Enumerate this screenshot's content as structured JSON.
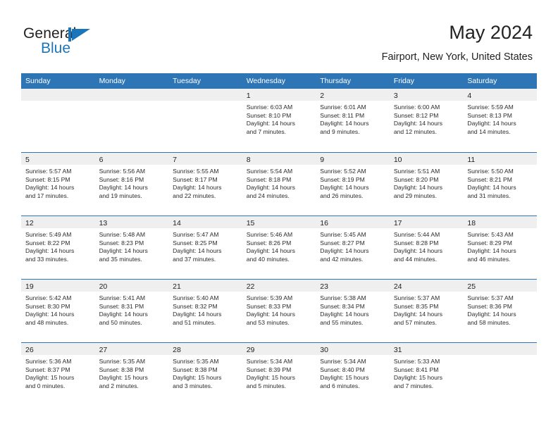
{
  "brand": {
    "name_part1": "General",
    "name_part2": "Blue"
  },
  "header": {
    "title": "May 2024",
    "location": "Fairport, New York, United States"
  },
  "calendar": {
    "weekday_headers": [
      "Sunday",
      "Monday",
      "Tuesday",
      "Wednesday",
      "Thursday",
      "Friday",
      "Saturday"
    ],
    "accent_color": "#2e75b6",
    "daynum_band_color": "#efefef",
    "weeks": [
      [
        {
          "day": "",
          "lines": []
        },
        {
          "day": "",
          "lines": []
        },
        {
          "day": "",
          "lines": []
        },
        {
          "day": "1",
          "lines": [
            "Sunrise: 6:03 AM",
            "Sunset: 8:10 PM",
            "Daylight: 14 hours",
            "and 7 minutes."
          ]
        },
        {
          "day": "2",
          "lines": [
            "Sunrise: 6:01 AM",
            "Sunset: 8:11 PM",
            "Daylight: 14 hours",
            "and 9 minutes."
          ]
        },
        {
          "day": "3",
          "lines": [
            "Sunrise: 6:00 AM",
            "Sunset: 8:12 PM",
            "Daylight: 14 hours",
            "and 12 minutes."
          ]
        },
        {
          "day": "4",
          "lines": [
            "Sunrise: 5:59 AM",
            "Sunset: 8:13 PM",
            "Daylight: 14 hours",
            "and 14 minutes."
          ]
        }
      ],
      [
        {
          "day": "5",
          "lines": [
            "Sunrise: 5:57 AM",
            "Sunset: 8:15 PM",
            "Daylight: 14 hours",
            "and 17 minutes."
          ]
        },
        {
          "day": "6",
          "lines": [
            "Sunrise: 5:56 AM",
            "Sunset: 8:16 PM",
            "Daylight: 14 hours",
            "and 19 minutes."
          ]
        },
        {
          "day": "7",
          "lines": [
            "Sunrise: 5:55 AM",
            "Sunset: 8:17 PM",
            "Daylight: 14 hours",
            "and 22 minutes."
          ]
        },
        {
          "day": "8",
          "lines": [
            "Sunrise: 5:54 AM",
            "Sunset: 8:18 PM",
            "Daylight: 14 hours",
            "and 24 minutes."
          ]
        },
        {
          "day": "9",
          "lines": [
            "Sunrise: 5:52 AM",
            "Sunset: 8:19 PM",
            "Daylight: 14 hours",
            "and 26 minutes."
          ]
        },
        {
          "day": "10",
          "lines": [
            "Sunrise: 5:51 AM",
            "Sunset: 8:20 PM",
            "Daylight: 14 hours",
            "and 29 minutes."
          ]
        },
        {
          "day": "11",
          "lines": [
            "Sunrise: 5:50 AM",
            "Sunset: 8:21 PM",
            "Daylight: 14 hours",
            "and 31 minutes."
          ]
        }
      ],
      [
        {
          "day": "12",
          "lines": [
            "Sunrise: 5:49 AM",
            "Sunset: 8:22 PM",
            "Daylight: 14 hours",
            "and 33 minutes."
          ]
        },
        {
          "day": "13",
          "lines": [
            "Sunrise: 5:48 AM",
            "Sunset: 8:23 PM",
            "Daylight: 14 hours",
            "and 35 minutes."
          ]
        },
        {
          "day": "14",
          "lines": [
            "Sunrise: 5:47 AM",
            "Sunset: 8:25 PM",
            "Daylight: 14 hours",
            "and 37 minutes."
          ]
        },
        {
          "day": "15",
          "lines": [
            "Sunrise: 5:46 AM",
            "Sunset: 8:26 PM",
            "Daylight: 14 hours",
            "and 40 minutes."
          ]
        },
        {
          "day": "16",
          "lines": [
            "Sunrise: 5:45 AM",
            "Sunset: 8:27 PM",
            "Daylight: 14 hours",
            "and 42 minutes."
          ]
        },
        {
          "day": "17",
          "lines": [
            "Sunrise: 5:44 AM",
            "Sunset: 8:28 PM",
            "Daylight: 14 hours",
            "and 44 minutes."
          ]
        },
        {
          "day": "18",
          "lines": [
            "Sunrise: 5:43 AM",
            "Sunset: 8:29 PM",
            "Daylight: 14 hours",
            "and 46 minutes."
          ]
        }
      ],
      [
        {
          "day": "19",
          "lines": [
            "Sunrise: 5:42 AM",
            "Sunset: 8:30 PM",
            "Daylight: 14 hours",
            "and 48 minutes."
          ]
        },
        {
          "day": "20",
          "lines": [
            "Sunrise: 5:41 AM",
            "Sunset: 8:31 PM",
            "Daylight: 14 hours",
            "and 50 minutes."
          ]
        },
        {
          "day": "21",
          "lines": [
            "Sunrise: 5:40 AM",
            "Sunset: 8:32 PM",
            "Daylight: 14 hours",
            "and 51 minutes."
          ]
        },
        {
          "day": "22",
          "lines": [
            "Sunrise: 5:39 AM",
            "Sunset: 8:33 PM",
            "Daylight: 14 hours",
            "and 53 minutes."
          ]
        },
        {
          "day": "23",
          "lines": [
            "Sunrise: 5:38 AM",
            "Sunset: 8:34 PM",
            "Daylight: 14 hours",
            "and 55 minutes."
          ]
        },
        {
          "day": "24",
          "lines": [
            "Sunrise: 5:37 AM",
            "Sunset: 8:35 PM",
            "Daylight: 14 hours",
            "and 57 minutes."
          ]
        },
        {
          "day": "25",
          "lines": [
            "Sunrise: 5:37 AM",
            "Sunset: 8:36 PM",
            "Daylight: 14 hours",
            "and 58 minutes."
          ]
        }
      ],
      [
        {
          "day": "26",
          "lines": [
            "Sunrise: 5:36 AM",
            "Sunset: 8:37 PM",
            "Daylight: 15 hours",
            "and 0 minutes."
          ]
        },
        {
          "day": "27",
          "lines": [
            "Sunrise: 5:35 AM",
            "Sunset: 8:38 PM",
            "Daylight: 15 hours",
            "and 2 minutes."
          ]
        },
        {
          "day": "28",
          "lines": [
            "Sunrise: 5:35 AM",
            "Sunset: 8:38 PM",
            "Daylight: 15 hours",
            "and 3 minutes."
          ]
        },
        {
          "day": "29",
          "lines": [
            "Sunrise: 5:34 AM",
            "Sunset: 8:39 PM",
            "Daylight: 15 hours",
            "and 5 minutes."
          ]
        },
        {
          "day": "30",
          "lines": [
            "Sunrise: 5:34 AM",
            "Sunset: 8:40 PM",
            "Daylight: 15 hours",
            "and 6 minutes."
          ]
        },
        {
          "day": "31",
          "lines": [
            "Sunrise: 5:33 AM",
            "Sunset: 8:41 PM",
            "Daylight: 15 hours",
            "and 7 minutes."
          ]
        },
        {
          "day": "",
          "lines": []
        }
      ]
    ]
  }
}
